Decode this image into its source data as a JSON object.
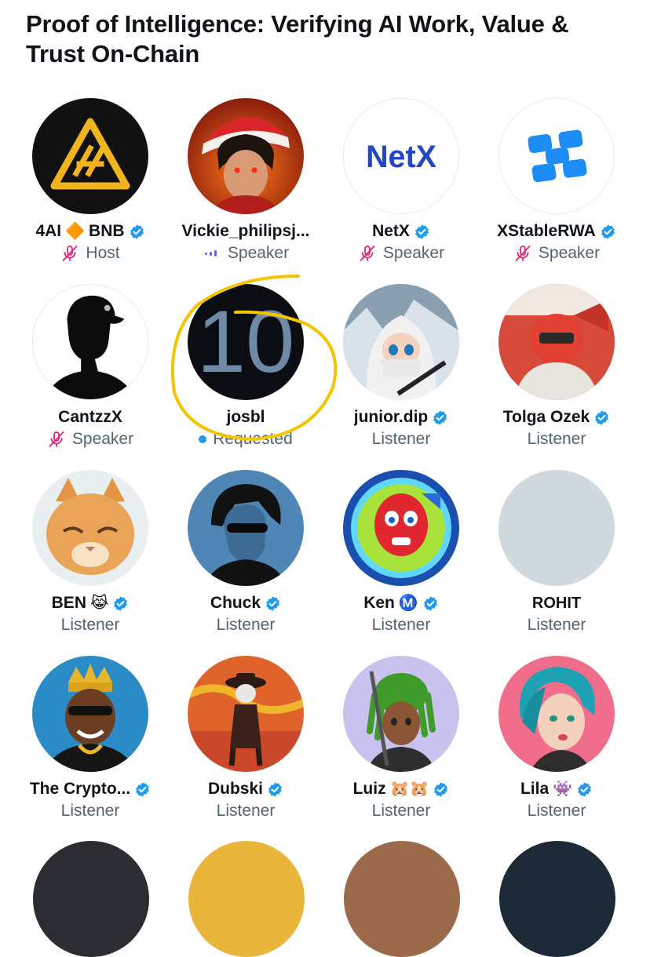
{
  "space": {
    "title": "Proof of Intelligence: Verifying AI Work, Value & Trust On-Chain"
  },
  "colors": {
    "verified": "#1d9bf0",
    "muted_mic": "#e0247a",
    "secondary_text": "#536471",
    "annotation": "#f5c400"
  },
  "participants": [
    {
      "name": "4AI",
      "emoji": "🔶",
      "suffix": "BNB",
      "verified": true,
      "role": "Host",
      "role_icon": "mic-muted-icon"
    },
    {
      "name": "Vickie_philipsj...",
      "verified": false,
      "role": "Speaker",
      "role_icon": "speaking-dots-icon"
    },
    {
      "name": "NetX",
      "verified": true,
      "role": "Speaker",
      "role_icon": "mic-muted-icon",
      "avatar_text": "NetX"
    },
    {
      "name": "XStableRWA",
      "verified": true,
      "role": "Speaker",
      "role_icon": "mic-muted-icon"
    },
    {
      "name": "CantzzX",
      "verified": false,
      "role": "Speaker",
      "role_icon": "mic-muted-icon"
    },
    {
      "name": "josbl",
      "verified": false,
      "role": "Requested",
      "role_icon": "requested-dot-icon",
      "avatar_text": "10"
    },
    {
      "name": "junior.dip",
      "verified": true,
      "role": "Listener"
    },
    {
      "name": "Tolga Ozek",
      "verified": true,
      "role": "Listener"
    },
    {
      "name": "BEN",
      "emoji": "😹",
      "verified": true,
      "role": "Listener"
    },
    {
      "name": "Chuck",
      "verified": true,
      "role": "Listener"
    },
    {
      "name": "Ken",
      "emoji": "Ⓜ️",
      "verified": true,
      "role": "Listener"
    },
    {
      "name": "ROHIT",
      "verified": false,
      "role": "Listener"
    },
    {
      "name": "The Crypto...",
      "verified": true,
      "role": "Listener"
    },
    {
      "name": "Dubski",
      "verified": true,
      "role": "Listener"
    },
    {
      "name": "Luiz",
      "emoji": "🐹🐹",
      "verified": true,
      "role": "Listener"
    },
    {
      "name": "Lila",
      "emoji": "👾",
      "verified": true,
      "role": "Listener"
    }
  ]
}
